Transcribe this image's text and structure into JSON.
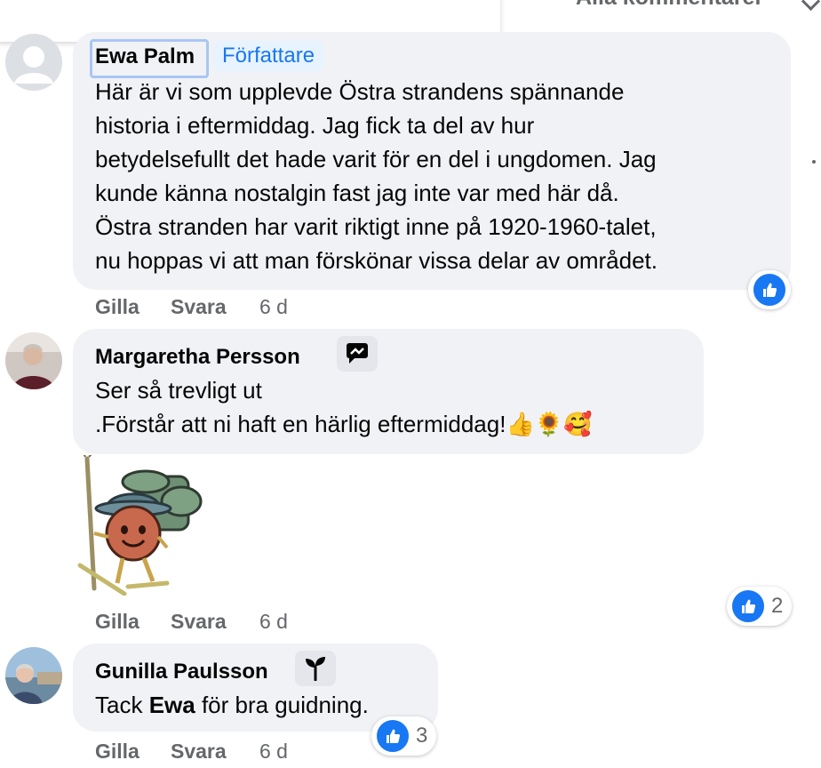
{
  "header": {
    "sort_label": "Alla kommentarer"
  },
  "comments": [
    {
      "author": "Ewa Palm",
      "author_badge": "Författare",
      "lines": [
        "Här är vi som upplevde Östra strandens spännande",
        "historia i eftermiddag. Jag fick ta del av hur",
        "betydelsefullt det hade varit för en del i ungdomen. Jag",
        "kunde känna nostalgin fast jag inte var med här då.",
        "Östra stranden har varit riktigt inne på 1920-1960-talet,",
        "nu hoppas vi att man förskönar vissa delar av området."
      ],
      "like_label": "Gilla",
      "reply_label": "Svara",
      "time": "6 d",
      "reaction_count": ""
    },
    {
      "author": "Margaretha Persson",
      "lines": [
        "Ser så trevligt ut",
        ".Förstår att ni haft en härlig eftermiddag!"
      ],
      "emojis": [
        "👍",
        "🌻",
        "🥰"
      ],
      "sticker": "hiker-sticker",
      "like_label": "Gilla",
      "reply_label": "Svara",
      "time": "6 d",
      "reaction_count": "2"
    },
    {
      "author": "Gunilla Paulsson",
      "text_prefix": "Tack ",
      "text_mention": "Ewa",
      "text_suffix": " för bra guidning.",
      "like_label": "Gilla",
      "reply_label": "Svara",
      "time": "6 d",
      "reaction_count": "3"
    }
  ],
  "colors": {
    "bubble": "#f0f2f5",
    "meta_text": "#65676b",
    "like_blue": "#1877f2",
    "author_badge_bg": "#e7f3ff"
  },
  "icons": [
    "default-avatar-icon",
    "like-icon",
    "conversation-starter-icon",
    "new-member-sprout-icon"
  ]
}
